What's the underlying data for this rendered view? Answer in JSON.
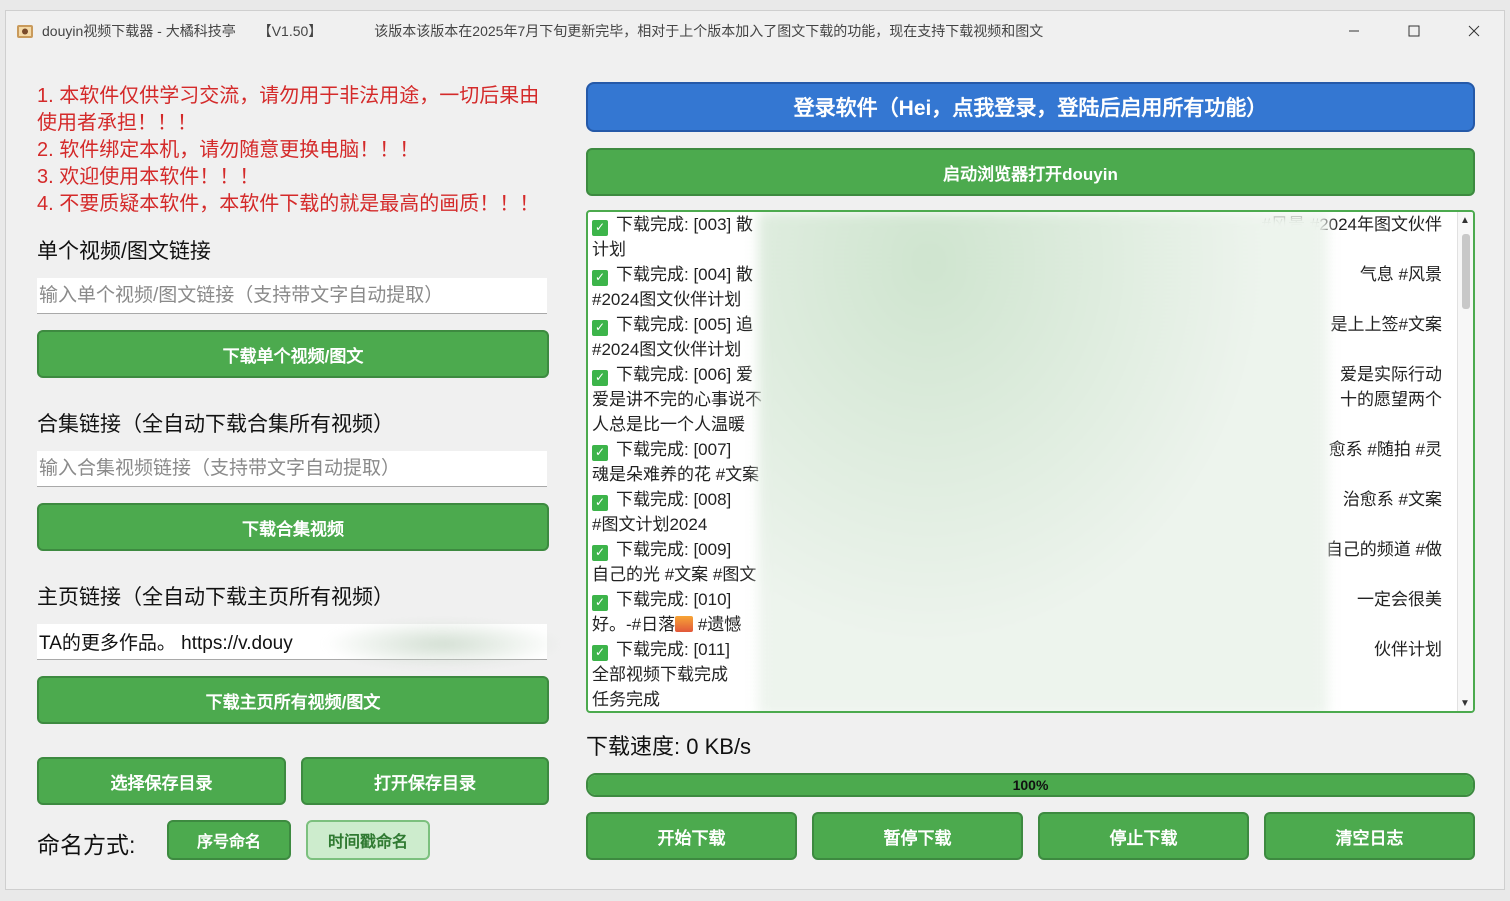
{
  "window": {
    "title": "douyin视频下载器 - 大橘科技亭",
    "version": "【V1.50】",
    "notice": "该版本该版本在2025年7月下旬更新完毕，相对于上个版本加入了图文下载的功能，现在支持下载视频和图文",
    "minimize_icon": "minimize-icon",
    "maximize_icon": "maximize-icon",
    "close_icon": "close-icon"
  },
  "warnings": [
    "1. 本软件仅供学习交流，请勿用于非法用途，一切后果由",
    "使用者承担！！！",
    "2. 软件绑定本机，请勿随意更换电脑！！！",
    "3. 欢迎使用本软件！！！",
    "4. 不要质疑本软件，本软件下载的就是最高的画质！！！"
  ],
  "single": {
    "label": "单个视频/图文链接",
    "placeholder": "输入单个视频/图文链接（支持带文字自动提取）",
    "button": "下载单个视频/图文"
  },
  "collection": {
    "label": "合集链接（全自动下载合集所有视频）",
    "placeholder": "输入合集视频链接（支持带文字自动提取）",
    "button": "下载合集视频"
  },
  "homepage": {
    "label": "主页链接（全自动下载主页所有视频）",
    "value": "TA的更多作品。 https://v.douy",
    "button": "下载主页所有视频/图文"
  },
  "save": {
    "choose_button": "选择保存目录",
    "open_button": "打开保存目录"
  },
  "naming": {
    "label": "命名方式:",
    "options": [
      "序号命名",
      "时间戳命名"
    ],
    "selected": "序号命名"
  },
  "login_button": "登录软件（Hei，点我登录，登陆后启用所有功能）",
  "browser_button": "启动浏览器打开douyin",
  "log": {
    "lines": [
      {
        "left": "下载完成: [003] 散",
        "right": "#风景 #2024年图文伙伴",
        "check": true
      },
      {
        "left": "计划",
        "right": "",
        "check": false
      },
      {
        "left": "下载完成: [004] 散",
        "right": "气息 #风景",
        "check": true
      },
      {
        "left": "#2024图文伙伴计划",
        "right": "",
        "check": false
      },
      {
        "left": "下载完成: [005] 追",
        "right": "是上上签#文案",
        "check": true
      },
      {
        "left": "#2024图文伙伴计划",
        "right": "",
        "check": false
      },
      {
        "left": "下载完成: [006] 爱",
        "right": "爱是实际行动",
        "check": true
      },
      {
        "left": "爱是讲不完的心事说不",
        "right": "十的愿望两个",
        "check": false
      },
      {
        "left": "人总是比一个人温暖",
        "right": "",
        "check": false
      },
      {
        "left": "下载完成: [007]",
        "right": "愈系 #随拍 #灵",
        "check": true
      },
      {
        "left": "魂是朵难养的花 #文案",
        "right": "",
        "check": false
      },
      {
        "left": "下载完成: [008]",
        "right": "治愈系 #文案",
        "check": true
      },
      {
        "left": "#图文计划2024",
        "right": "",
        "check": false
      },
      {
        "left": "下载完成: [009]",
        "right": "自己的频道 #做",
        "check": true
      },
      {
        "left": "自己的光 #文案 #图文",
        "right": "",
        "check": false
      },
      {
        "left": "下载完成: [010]",
        "right": "一定会很美",
        "check": true
      },
      {
        "left": "好。-#日落",
        "right": "",
        "check": false,
        "sunset": true,
        "after": " #遗憾"
      },
      {
        "left": "下载完成: [011]",
        "right": "伙伴计划",
        "check": true
      },
      {
        "left": "全部视频下载完成",
        "right": "",
        "check": false
      },
      {
        "left": "任务完成",
        "right": "",
        "check": false
      }
    ]
  },
  "speed": {
    "label": "下载速度:",
    "value": "0 KB/s"
  },
  "progress": {
    "percent": 100,
    "label": "100%"
  },
  "controls": {
    "start": "开始下载",
    "pause": "暂停下载",
    "stop": "停止下载",
    "clear": "清空日志"
  },
  "colors": {
    "green": "#4caa4e",
    "blue": "#3477d2",
    "red_text": "#d42a2a"
  }
}
